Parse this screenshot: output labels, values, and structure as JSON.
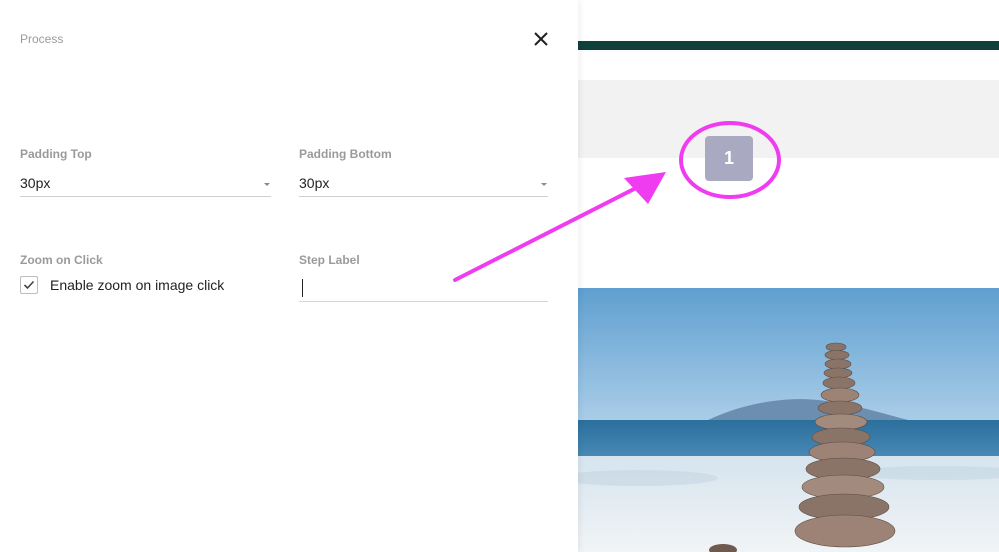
{
  "panel": {
    "title": "Process",
    "close_icon": "close-icon",
    "padding_top": {
      "label": "Padding Top",
      "value": "30px"
    },
    "padding_bottom": {
      "label": "Padding Bottom",
      "value": "30px"
    },
    "zoom_on_click": {
      "label": "Zoom on Click",
      "checkbox_label": "Enable zoom on image click",
      "checked": true
    },
    "step_label": {
      "label": "Step Label",
      "value": ""
    }
  },
  "preview": {
    "step_number": "1",
    "accent_color": "#10403a",
    "badge_color": "#a9a9c2"
  },
  "annotation": {
    "color": "#f03cf0"
  }
}
